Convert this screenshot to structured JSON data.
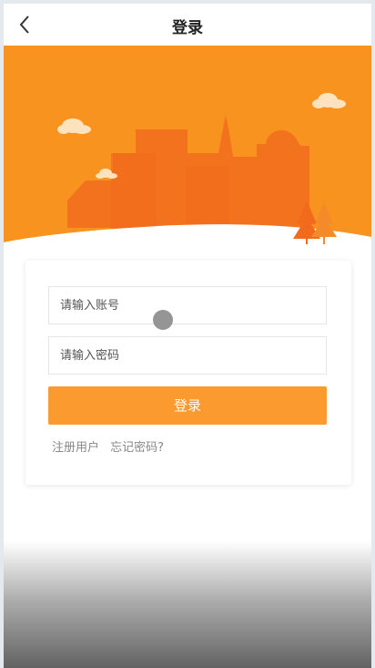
{
  "header": {
    "title": "登录"
  },
  "form": {
    "account_placeholder": "请输入账号",
    "password_placeholder": "请输入密码",
    "login_label": "登录"
  },
  "links": {
    "register": "注册用户",
    "forgot": "忘记密码?"
  },
  "colors": {
    "accent": "#fb9a2e",
    "banner": "#f7931e"
  }
}
